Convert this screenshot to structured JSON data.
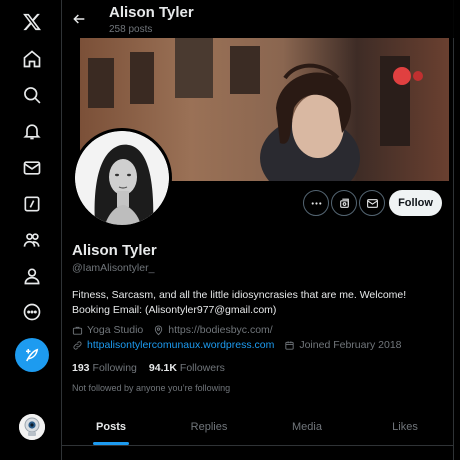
{
  "nav": {
    "items": [
      {
        "name": "x-logo-icon"
      },
      {
        "name": "home-icon"
      },
      {
        "name": "search-icon"
      },
      {
        "name": "notifications-icon"
      },
      {
        "name": "messages-icon"
      },
      {
        "name": "grok-icon"
      },
      {
        "name": "communities-icon"
      },
      {
        "name": "profile-icon"
      },
      {
        "name": "more-icon"
      }
    ],
    "post_icon": "feather-plus-icon"
  },
  "header": {
    "name": "Alison Tyler",
    "post_count": "258 posts"
  },
  "profile": {
    "display_name": "Alison Tyler",
    "handle": "@IamAlisontyler_",
    "bio": "Fitness, Sarcasm, and all the little idiosyncrasies that are me. Welcome! Booking Email: (Alisontyler977@gmail.com)",
    "category": "Yoga Studio",
    "location": "https://bodiesbyc.com/",
    "website": "httpalisontylercomunaux.wordpress.com",
    "joined": "Joined February 2018",
    "following_count": "193",
    "following_label": "Following",
    "followers_count": "94.1K",
    "followers_label": "Followers",
    "not_followed": "Not followed by anyone you’re following"
  },
  "actions": {
    "follow_label": "Follow"
  },
  "tabs": [
    {
      "label": "Posts"
    },
    {
      "label": "Replies"
    },
    {
      "label": "Media"
    },
    {
      "label": "Likes"
    }
  ],
  "colors": {
    "accent": "#1d9bf0",
    "background": "#000000",
    "text": "#e7e9ea",
    "muted": "#71767b"
  }
}
